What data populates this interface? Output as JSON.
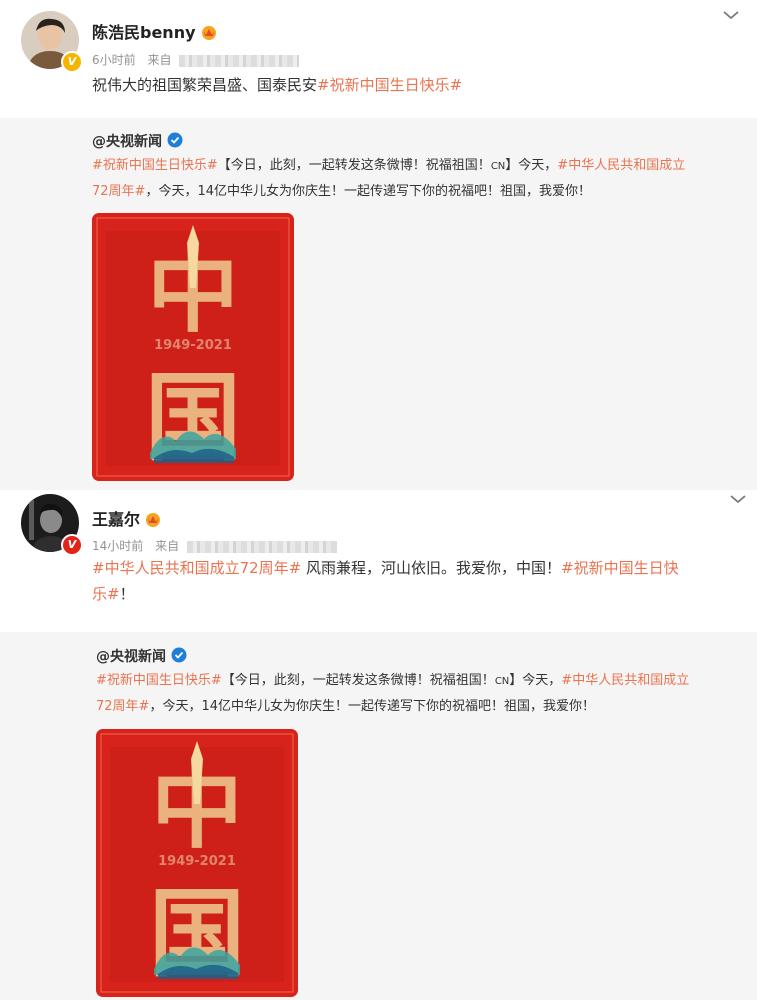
{
  "posts": [
    {
      "username": "陈浩民benny",
      "time": "6小时前",
      "source_prefix": "来自",
      "text": "祝伟大的祖国繁荣昌盛、国泰民安",
      "hashtag": "#祝新中国生日快乐#",
      "repost": {
        "author": "@央视新闻",
        "tag_start": "#祝新中国生日快乐#",
        "text_a": "【今日，此刻，一起转发这条微博！祝福祖国！",
        "cn_label": "CN",
        "text_b": "】今天，",
        "tag_mid_line1": "#中华人民共和国成立",
        "tag_mid_line2": "72周年#",
        "text_c": "，今天，14亿中华儿女为你庆生！一起传递写下你的祝福吧！祖国，我爱你！",
        "poster_years": "1949-2021",
        "poster_char_top": "中",
        "poster_char_bottom": "国"
      }
    },
    {
      "username": "王嘉尔",
      "time": "14小时前",
      "source_prefix": "来自",
      "tag_start": "#中华人民共和国成立72周年#",
      "text_mid": " 风雨兼程，河山依旧。我爱你，中国！",
      "tag_end_line1": "#祝新中国生日快",
      "tag_end_line2": "乐#",
      "text_end": "！",
      "repost": {
        "author": "@央视新闻",
        "tag_start": "#祝新中国生日快乐#",
        "text_a": "【今日，此刻，一起转发这条微博！祝福祖国！",
        "cn_label": "CN",
        "text_b": "】今天，",
        "tag_mid_line1": "#中华人民共和国成立",
        "tag_mid_line2": "72周年#",
        "text_c": "，今天，14亿中华儿女为你庆生！一起传递写下你的祝福吧！祖国，我爱你！",
        "poster_years": "1949-2021",
        "poster_char_top": "中",
        "poster_char_bottom": "国"
      }
    }
  ],
  "colors": {
    "hashtag": "#eb7350",
    "repost_bg": "#f5f5f5",
    "poster_red": "#d8231c",
    "verified_blue": "#1e7fd8"
  },
  "icons": [
    "chevron-down-icon",
    "crown-badge-icon",
    "verified-icon",
    "avatar-badge-icon"
  ]
}
